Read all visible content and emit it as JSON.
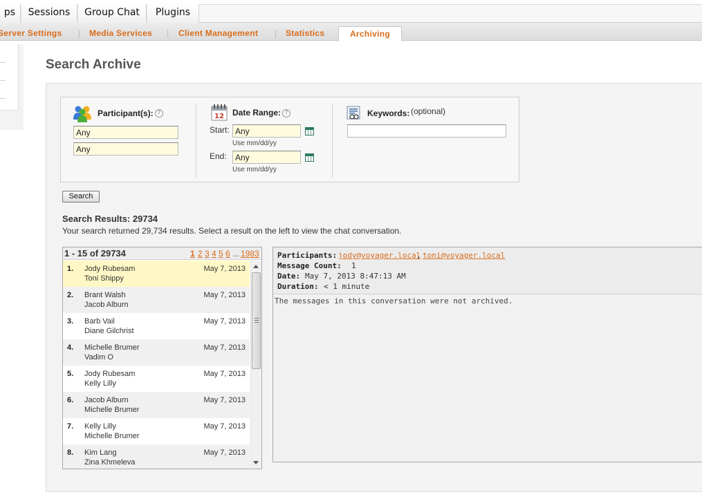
{
  "top_tabs": [
    "ps",
    "Sessions",
    "Group Chat",
    "Plugins"
  ],
  "sub_tabs": [
    "Server Settings",
    "Media Services",
    "Client Management",
    "Statistics",
    "Archiving"
  ],
  "page_title": "Search Archive",
  "criteria": {
    "participants_label": "Participant(s):",
    "participant1": "Any",
    "participant2": "Any",
    "date_range_label": "Date Range:",
    "start_label": "Start:",
    "start_value": "Any",
    "start_hint": "Use mm/dd/yy",
    "end_label": "End:",
    "end_value": "Any",
    "end_hint": "Use mm/dd/yy",
    "keywords_label": "Keywords:",
    "keywords_optional": "(optional)",
    "keywords_value": "",
    "help_glyph": "?"
  },
  "search_button": "Search",
  "results": {
    "title": "Search Results: 29734",
    "description": "Your search returned 29,734 results. Select a result on the left to view the chat conversation.",
    "range": "1 - 15 of 29734",
    "pages": [
      "1",
      "2",
      "3",
      "4",
      "5",
      "6"
    ],
    "ellipsis": "...",
    "last_page": "1983",
    "rows": [
      {
        "num": "1.",
        "p1": "Jody Rubesam",
        "p2": "Toni Shippy",
        "date": "May 7, 2013"
      },
      {
        "num": "2.",
        "p1": "Brant Walsh",
        "p2": "Jacob Alburn",
        "date": "May 7, 2013"
      },
      {
        "num": "3.",
        "p1": "Barb Vail",
        "p2": "Diane Gilchrist",
        "date": "May 7, 2013"
      },
      {
        "num": "4.",
        "p1": "Michelle Brumer",
        "p2": "Vadim O",
        "date": "May 7, 2013"
      },
      {
        "num": "5.",
        "p1": "Jody Rubesam",
        "p2": "Kelly Lilly",
        "date": "May 7, 2013"
      },
      {
        "num": "6.",
        "p1": "Jacob Alburn",
        "p2": "Michelle Brumer",
        "date": "May 7, 2013"
      },
      {
        "num": "7.",
        "p1": "Kelly Lilly",
        "p2": "Michelle Brumer",
        "date": "May 7, 2013"
      },
      {
        "num": "8.",
        "p1": "Kim Lang",
        "p2": "Zina Khmeleva",
        "date": "May 7, 2013"
      }
    ]
  },
  "detail": {
    "participants_label": "Participants:",
    "participant_a": "jody@voyager.local",
    "comma": ",",
    "participant_b": "toni@voyager.local",
    "message_count_label": "Message Count:",
    "message_count": "1",
    "date_label": "Date:",
    "date": "May 7, 2013 8:47:13 AM",
    "duration_label": "Duration:",
    "duration": "< 1 minute",
    "message": "The messages in this conversation were not archived."
  },
  "colors": {
    "accent": "#d86c1a",
    "selected_row": "#fff8c6",
    "alt_row": "#f0f0f0",
    "field_bg": "#fffbdf"
  }
}
